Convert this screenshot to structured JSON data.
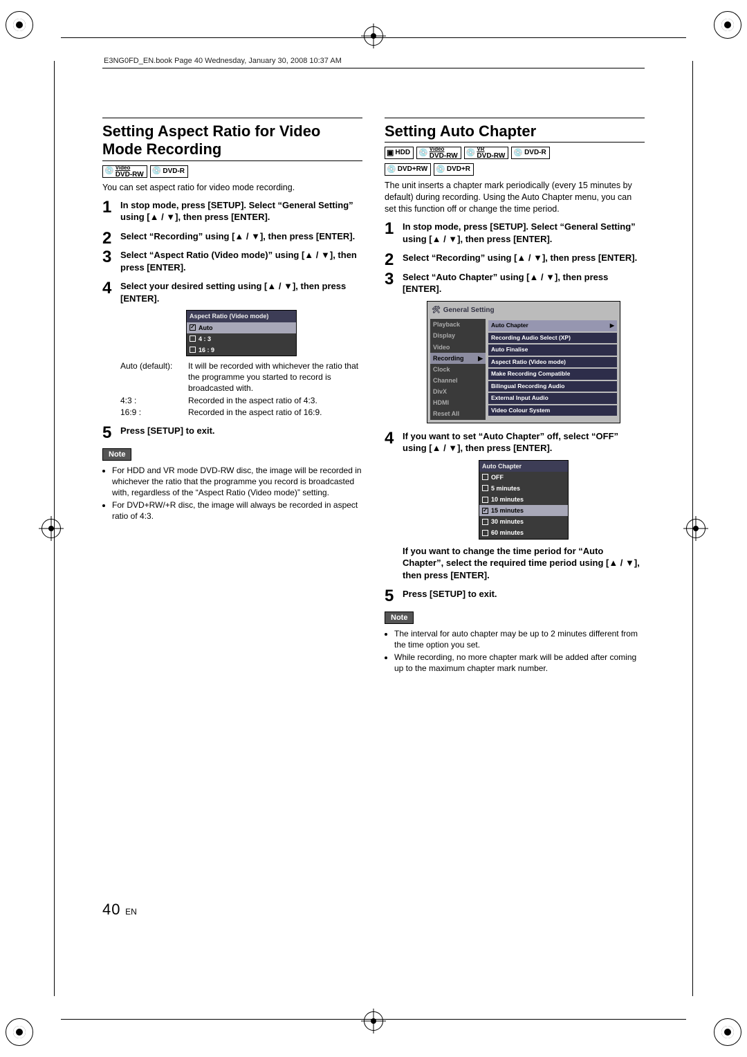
{
  "bookline": "E3NG0FD_EN.book  Page 40  Wednesday, January 30, 2008  10:37 AM",
  "left": {
    "title": "Setting Aspect Ratio for Video Mode Recording",
    "discs": [
      "DVD-RW",
      "DVD-R"
    ],
    "disc_sup": [
      "Video",
      ""
    ],
    "lead": "You can set aspect ratio for video mode recording.",
    "step1": "In stop mode, press [SETUP]. Select “General Setting” using [▲ / ▼], then press [ENTER].",
    "step2": "Select “Recording” using [▲ / ▼], then press [ENTER].",
    "step3": "Select “Aspect Ratio (Video mode)” using [▲ / ▼], then press [ENTER].",
    "step4": "Select your desired setting using [▲ / ▼], then press [ENTER].",
    "osd1": {
      "title": "Aspect Ratio (Video mode)",
      "opts": [
        "Auto",
        "4 : 3",
        "16 : 9"
      ],
      "selected_index": 0
    },
    "defs": [
      {
        "term": "Auto (default):",
        "val": "It will be recorded with whichever the ratio that the programme you started to record is broadcasted with."
      },
      {
        "term": "4:3 :",
        "val": "Recorded in the aspect ratio of 4:3."
      },
      {
        "term": "16:9 :",
        "val": "Recorded in the aspect ratio of 16:9."
      }
    ],
    "step5": "Press [SETUP] to exit.",
    "note_label": "Note",
    "notes": [
      "For HDD and VR mode DVD-RW disc, the image will be recorded in whichever the ratio that the programme you record is broadcasted with, regardless of the “Aspect Ratio (Video mode)” setting.",
      "For DVD+RW/+R disc, the image will always be recorded in aspect ratio of 4:3."
    ]
  },
  "right": {
    "title": "Setting Auto Chapter",
    "discs_row1": [
      "HDD",
      "DVD-RW",
      "DVD-RW",
      "DVD-R"
    ],
    "disc_sup_row1": [
      "",
      "Video",
      "VR",
      ""
    ],
    "discs_row2": [
      "DVD+RW",
      "DVD+R"
    ],
    "disc_sup_row2": [
      "",
      ""
    ],
    "lead": "The unit inserts a chapter mark periodically (every 15 minutes by default) during recording. Using the Auto Chapter menu, you can set this function off or change the time period.",
    "step1": "In stop mode, press [SETUP]. Select “General Setting” using [▲ / ▼], then press [ENTER].",
    "step2": "Select “Recording” using [▲ / ▼], then press [ENTER].",
    "step3": "Select “Auto Chapter” using [▲ / ▼], then press [ENTER].",
    "osd2": {
      "header": "General Setting",
      "sidebar": [
        "Playback",
        "Display",
        "Video",
        "Recording",
        "Clock",
        "Channel",
        "DivX",
        "HDMI",
        "Reset All"
      ],
      "sidebar_selected_index": 3,
      "entries": [
        "Auto Chapter",
        "Recording Audio Select (XP)",
        "Auto Finalise",
        "Aspect Ratio (Video mode)",
        "Make Recording Compatible",
        "Bilingual Recording Audio",
        "External Input Audio",
        "Video Colour System"
      ],
      "entry_selected_index": 0
    },
    "step4": "If you want to set “Auto Chapter” off, select “OFF” using [▲ / ▼], then press [ENTER].",
    "osd3": {
      "title": "Auto Chapter",
      "opts": [
        "OFF",
        "  5 minutes",
        "10 minutes",
        "15 minutes",
        "30 minutes",
        "60 minutes"
      ],
      "selected_index": 3
    },
    "para": "If you want to change the time period for “Auto Chapter”, select the required time period using [▲ / ▼], then press [ENTER].",
    "step5": "Press [SETUP] to exit.",
    "note_label": "Note",
    "notes": [
      "The interval for auto chapter may be up to 2 minutes different from the time option you set.",
      "While recording, no more chapter mark will be added after coming up to the maximum chapter mark number."
    ]
  },
  "page": {
    "num": "40",
    "lang": "EN"
  }
}
